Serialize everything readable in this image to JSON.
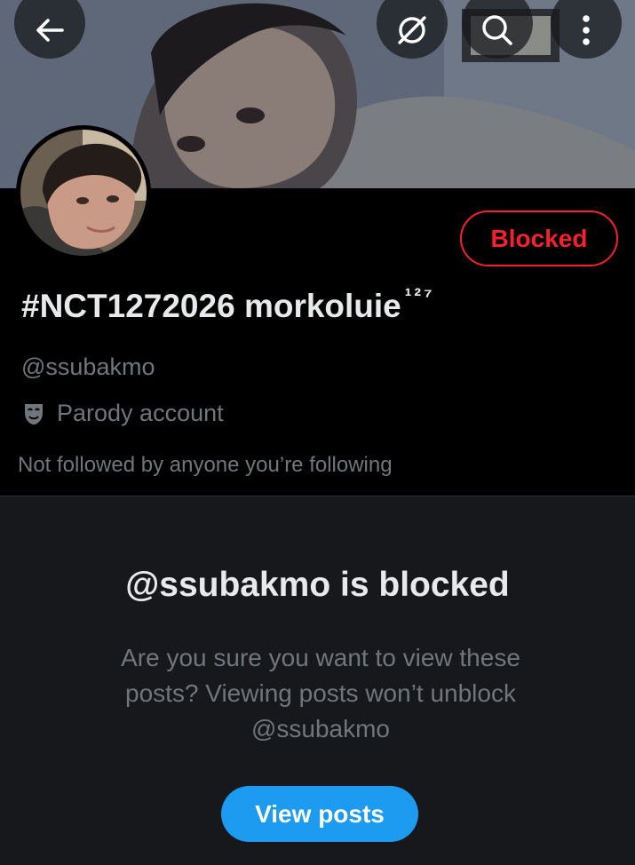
{
  "header": {
    "back_icon": "arrow-left-icon",
    "grok_icon": "grok-icon",
    "search_icon": "search-icon",
    "more_icon": "more-vertical-icon"
  },
  "profile": {
    "status_button_label": "Blocked",
    "display_name": "#NCT1272026 morkoluie",
    "display_name_suffix": "¹²⁷",
    "handle": "@ssubakmo",
    "parody_icon": "theater-mask-icon",
    "parody_label": "Parody account",
    "followers_you_know": "Not followed by anyone you’re following"
  },
  "blocked_notice": {
    "title": "@ssubakmo is blocked",
    "description": "Are you sure you want to view these posts? Viewing posts won’t unblock @ssubakmo",
    "button_label": "View posts"
  },
  "colors": {
    "background": "#000000",
    "panel_background": "#16181c",
    "primary_text": "#e7e9ea",
    "secondary_text": "#71767b",
    "blocked_red": "#f4212e",
    "accent_blue": "#1d9bf0"
  }
}
